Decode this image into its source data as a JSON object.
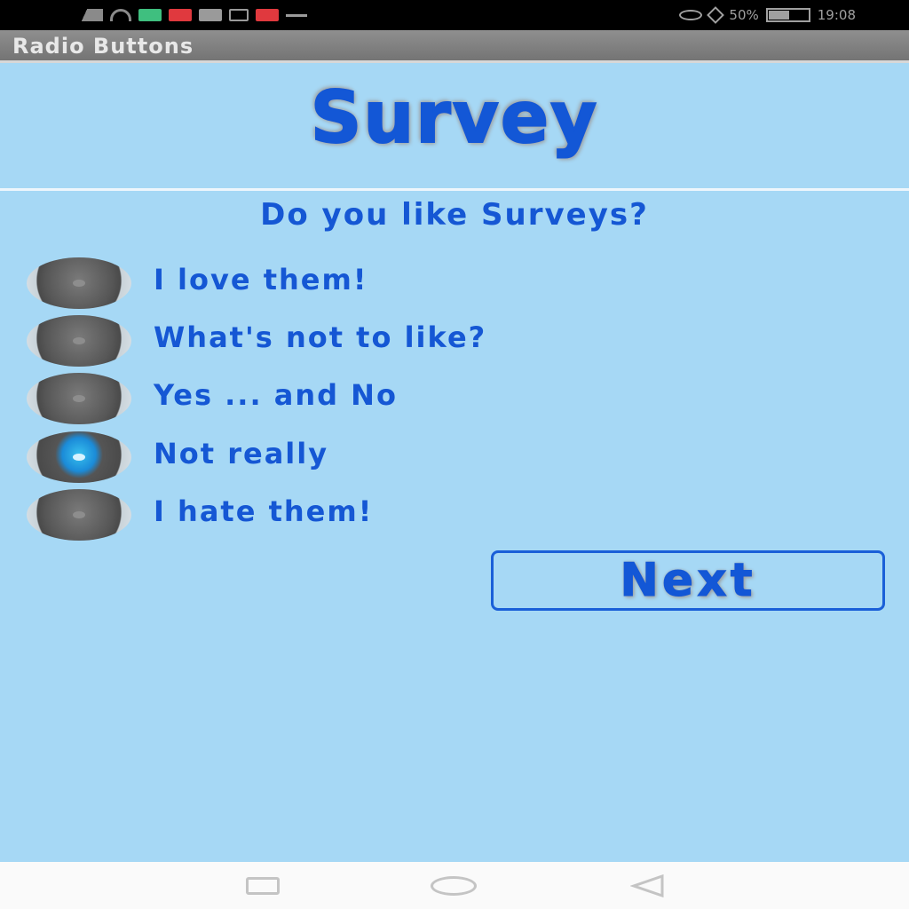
{
  "status_bar": {
    "right_text": "50%",
    "time": "19:08",
    "icons": [
      "signal-icon",
      "wifi-icon",
      "notification-icon",
      "eye-icon",
      "bluetooth-icon",
      "battery-icon"
    ]
  },
  "app": {
    "title": "Radio Buttons"
  },
  "header": {
    "title": "Survey"
  },
  "survey": {
    "question": "Do you like Surveys?",
    "options": [
      {
        "label": "I love them!",
        "checked": false
      },
      {
        "label": "What's not to like?",
        "checked": false
      },
      {
        "label": "Yes ... and No",
        "checked": false
      },
      {
        "label": "Not really",
        "checked": true
      },
      {
        "label": "I hate them!",
        "checked": false
      }
    ],
    "selected_index": 3,
    "next_label": "Next"
  },
  "colors": {
    "background": "#a6d8f5",
    "text": "#1557d4",
    "radio_selected": "#1b8bd8"
  },
  "nav_bar": {
    "buttons": [
      "recents-icon",
      "home-icon",
      "back-icon"
    ]
  }
}
